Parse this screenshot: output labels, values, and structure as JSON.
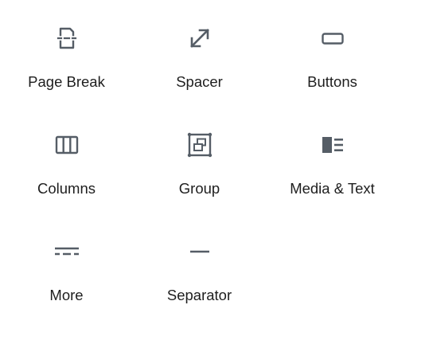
{
  "blocks": [
    {
      "label": "Page Break",
      "icon": "page-break-icon"
    },
    {
      "label": "Spacer",
      "icon": "spacer-icon"
    },
    {
      "label": "Buttons",
      "icon": "buttons-icon"
    },
    {
      "label": "Columns",
      "icon": "columns-icon"
    },
    {
      "label": "Group",
      "icon": "group-icon"
    },
    {
      "label": "Media & Text",
      "icon": "media-text-icon"
    },
    {
      "label": "More",
      "icon": "more-icon"
    },
    {
      "label": "Separator",
      "icon": "separator-icon"
    }
  ],
  "colors": {
    "icon": "#555d66",
    "text": "#1e1e1e",
    "background": "#ffffff"
  }
}
